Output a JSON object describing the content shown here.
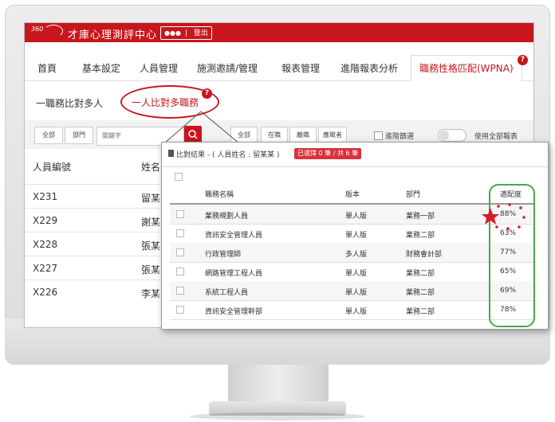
{
  "header": {
    "logo_text": "360",
    "app_title": "才庫心理測評中心",
    "user_dots": "●●●",
    "logout_label": "登出"
  },
  "tabs": [
    {
      "label": "首頁"
    },
    {
      "label": "基本設定"
    },
    {
      "label": "人員管理"
    },
    {
      "label": "施測邀請/管理"
    },
    {
      "label": "報表管理"
    },
    {
      "label": "進階報表分析"
    },
    {
      "label": "職務性格匹配(WPNA)"
    }
  ],
  "help_icon_glyph": "?",
  "subtabs": [
    {
      "label": "一職務比對多人"
    },
    {
      "label": "一人比對多職務"
    }
  ],
  "filter": {
    "all_label": "全部",
    "dept_label": "部門",
    "keyword_placeholder": "關鍵字",
    "status_all": "全部",
    "status_in": "在職",
    "status_out": "離職",
    "status_pending": "應徵者",
    "advanced_label": "進階篩選",
    "use_all_reports_label": "使用全部報表"
  },
  "back_table": {
    "headers": [
      "人員編號",
      "姓名"
    ],
    "rows": [
      {
        "id": "X231",
        "name": "留某"
      },
      {
        "id": "X229",
        "name": "謝某"
      },
      {
        "id": "X228",
        "name": "張某"
      },
      {
        "id": "X227",
        "name": "張某"
      },
      {
        "id": "X226",
        "name": "李某"
      }
    ]
  },
  "popup": {
    "title": "比對結果 - ( 人員姓名 : 留某某 )",
    "selected_badge": "已選擇 0 筆 / 共 6 筆",
    "columns": [
      "職務名稱",
      "版本",
      "部門",
      "適配度"
    ],
    "rows": [
      {
        "job": "業務規劃人員",
        "version": "單人版",
        "dept": "業務一部",
        "fit": "88%"
      },
      {
        "job": "資訊安全管理人員",
        "version": "單人版",
        "dept": "業務二部",
        "fit": "63%"
      },
      {
        "job": "行政管理師",
        "version": "多人版",
        "dept": "財務會計部",
        "fit": "77%"
      },
      {
        "job": "網路管理工程人員",
        "version": "單人版",
        "dept": "業務二部",
        "fit": "65%"
      },
      {
        "job": "系統工程人員",
        "version": "單人版",
        "dept": "業務二部",
        "fit": "69%"
      },
      {
        "job": "資訊安全管理幹部",
        "version": "單人版",
        "dept": "業務二部",
        "fit": "78%"
      }
    ]
  },
  "colors": {
    "brand_red": "#c8161d",
    "highlight_green": "#4aa84a"
  }
}
